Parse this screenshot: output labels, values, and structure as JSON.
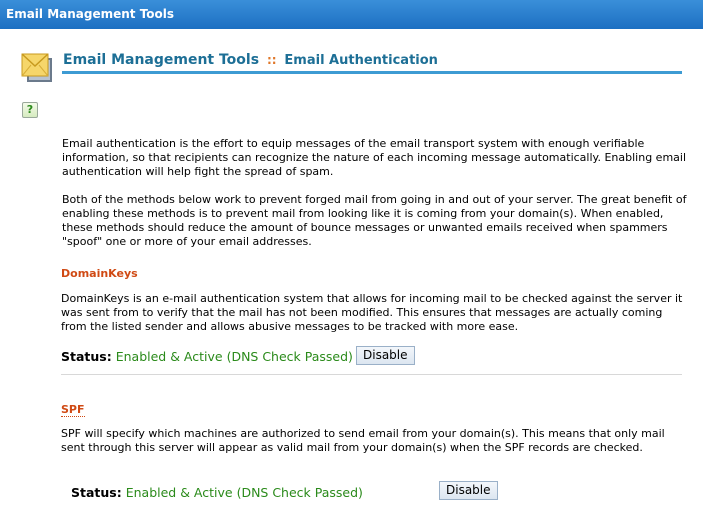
{
  "window": {
    "title": "Email Management Tools"
  },
  "header": {
    "title": "Email Management Tools",
    "separator": "::",
    "subtitle": "Email Authentication"
  },
  "icons": {
    "envelope": "envelope-icon",
    "help": "help-icon",
    "help_glyph": "?"
  },
  "intro": {
    "para1": "Email authentication is the effort to equip messages of the email transport system with enough verifiable information, so that recipients can recognize the nature of each incoming message automatically. Enabling email authentication will help fight the spread of spam.",
    "para2": "Both of the methods below work to prevent forged mail from going in and out of your server. The great benefit of enabling these methods is to prevent mail from looking like it is coming from your domain(s). When enabled, these methods should reduce the amount of bounce messages or unwanted emails received when spammers \"spoof\" one or more of your email addresses."
  },
  "domainkeys": {
    "heading": "DomainKeys",
    "description": "DomainKeys is an e-mail authentication system that allows for incoming mail to be checked against the server it was sent from to verify that the mail has not been modified. This ensures that messages are actually coming from the listed sender and allows abusive messages to be tracked with more ease.",
    "status_label": "Status:",
    "status_value": "Enabled & Active (DNS Check Passed)",
    "button_label": "Disable"
  },
  "spf": {
    "heading": "SPF",
    "description": "SPF will specify which machines are authorized to send email from your domain(s). This means that only mail sent through this server will appear as valid mail from your domain(s) when the SPF records are checked.",
    "status_label": "Status:",
    "status_value": "Enabled & Active (DNS Check Passed)",
    "button_label": "Disable"
  },
  "colors": {
    "titlebar": "#1c6fc2",
    "header_text": "#1d6f96",
    "section_heading": "#d04a14",
    "status_ok": "#2a8a1a"
  }
}
